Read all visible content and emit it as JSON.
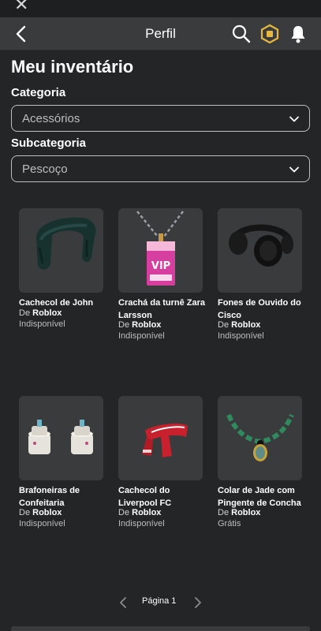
{
  "header": {
    "title": "Perfil"
  },
  "page": {
    "title": "Meu inventário"
  },
  "filters": {
    "category_label": "Categoria",
    "category_value": "Acessórios",
    "subcategory_label": "Subcategoria",
    "subcategory_value": "Pescoço"
  },
  "items": [
    {
      "name": "Cachecol de John",
      "by": "De",
      "creator": "Roblox",
      "price": "Indisponível"
    },
    {
      "name": "Crachá da turnê Zara Larsson",
      "by": "De",
      "creator": "Roblox",
      "price": "Indisponível"
    },
    {
      "name": "Fones de Ouvido do Cisco",
      "by": "De",
      "creator": "Roblox",
      "price": "Indisponível"
    },
    {
      "name": "Brafoneiras de Confeitaria",
      "by": "De",
      "creator": "Roblox",
      "price": "Indisponível"
    },
    {
      "name": "Cachecol do Liverpool FC",
      "by": "De",
      "creator": "Roblox",
      "price": "Indisponível"
    },
    {
      "name": "Colar de Jade com Pingente de Concha",
      "by": "De",
      "creator": "Roblox",
      "price": "Grátis"
    }
  ],
  "pagination": {
    "label": "Página 1"
  },
  "icons": {
    "close": "close-icon",
    "back": "chevron-left-icon",
    "search": "search-icon",
    "robux": "robux-icon",
    "bell": "bell-icon"
  },
  "colors": {
    "background": "#232527",
    "header": "#393b3d",
    "card": "#393b3d",
    "robux": "#e8b941"
  }
}
